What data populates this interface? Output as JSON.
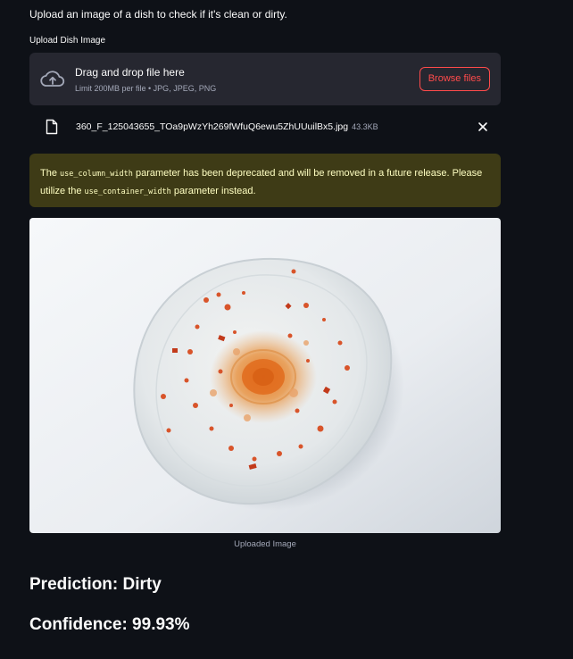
{
  "intro_text": "Upload an image of a dish to check if it's clean or dirty.",
  "uploader": {
    "label": "Upload Dish Image",
    "dropzone_title": "Drag and drop file here",
    "dropzone_limit": "Limit 200MB per file • JPG, JPEG, PNG",
    "browse_label": "Browse files",
    "cloud_icon": "cloud-upload-icon"
  },
  "file": {
    "name": "360_F_125043655_TOa9pWzYh269fWfuQ6ewu5ZhUUuilBx5.jpg",
    "size": "43.3KB",
    "icon": "file-icon",
    "close_icon": "close-icon"
  },
  "warning": {
    "part1": "The ",
    "code1": "use_column_width",
    "part2": " parameter has been deprecated and will be removed in a future release. Please utilize the ",
    "code2": "use_container_width",
    "part3": " parameter instead."
  },
  "image": {
    "caption": "Uploaded Image",
    "alt": "white plate with leftover tomato sauce"
  },
  "result": {
    "prediction": "Prediction: Dirty",
    "confidence": "Confidence: 99.93%"
  },
  "colors": {
    "background": "#0e1117",
    "panel": "#262730",
    "accent": "#ff4b4b",
    "warning_bg": "#3e3b16",
    "warning_text": "#ffffc2",
    "muted": "#a3a8b8"
  }
}
